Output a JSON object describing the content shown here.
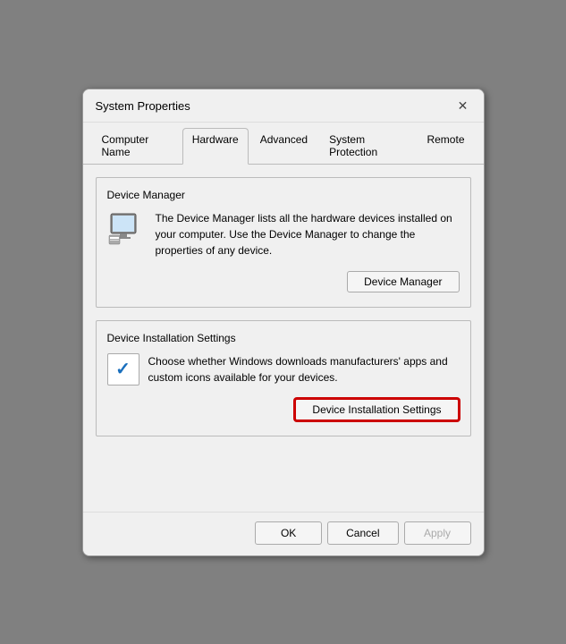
{
  "window": {
    "title": "System Properties",
    "close_label": "✕"
  },
  "tabs": [
    {
      "label": "Computer Name",
      "active": false
    },
    {
      "label": "Hardware",
      "active": true
    },
    {
      "label": "Advanced",
      "active": false
    },
    {
      "label": "System Protection",
      "active": false
    },
    {
      "label": "Remote",
      "active": false
    }
  ],
  "device_manager_section": {
    "label": "Device Manager",
    "description": "The Device Manager lists all the hardware devices installed on your computer. Use the Device Manager to change the properties of any device.",
    "button_label": "Device Manager"
  },
  "device_installation_section": {
    "label": "Device Installation Settings",
    "description": "Choose whether Windows downloads manufacturers' apps and custom icons available for your devices.",
    "button_label": "Device Installation Settings"
  },
  "footer": {
    "ok_label": "OK",
    "cancel_label": "Cancel",
    "apply_label": "Apply"
  }
}
